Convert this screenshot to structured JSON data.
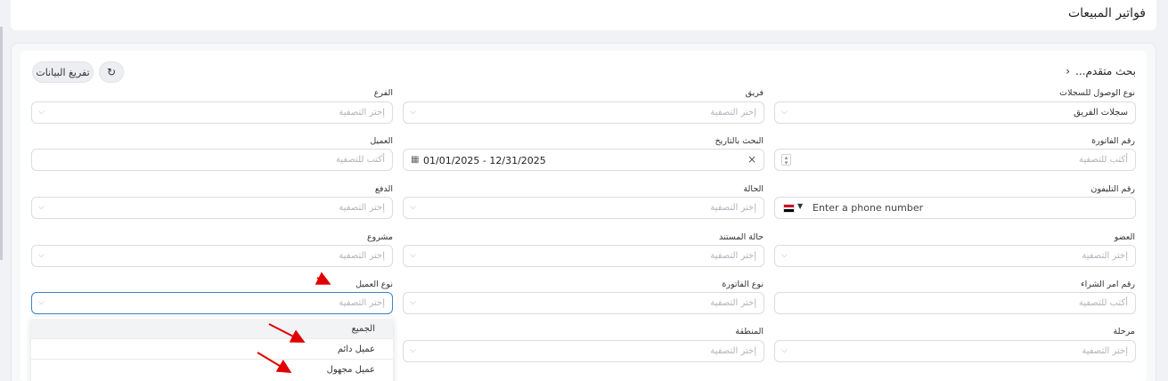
{
  "page": {
    "title": "فواتير المبيعات"
  },
  "toolbar": {
    "clear_label": "تفريغ البيانات",
    "refresh_icon": "refresh-icon"
  },
  "advanced_search": {
    "label": "بحث متقدم..."
  },
  "filters": {
    "access_type": {
      "label": "نوع الوصول للسجلات",
      "value": "سجلات الفريق"
    },
    "team": {
      "label": "فريق",
      "placeholder": "إختر التصفية"
    },
    "branch": {
      "label": "الفرع",
      "placeholder": "إختر التصفية"
    },
    "invoice_number": {
      "label": "رقم الفاتورة",
      "placeholder": "أكتب للتصفية"
    },
    "date_search": {
      "label": "البحث بالتاريخ",
      "value": "01/01/2025 - 12/31/2025"
    },
    "client": {
      "label": "العميل",
      "placeholder": "أكتب للتصفية"
    },
    "phone": {
      "label": "رقم التليفون",
      "placeholder": "Enter a phone number"
    },
    "status": {
      "label": "الحالة",
      "placeholder": "إختر التصفية"
    },
    "payment": {
      "label": "الدفع",
      "placeholder": "إختر التصفية"
    },
    "member": {
      "label": "العضو",
      "placeholder": "إختر التصفية"
    },
    "doc_status": {
      "label": "حالة المستند",
      "placeholder": "إختر التصفية"
    },
    "project": {
      "label": "مشروع",
      "placeholder": "إختر التصفية"
    },
    "po_number": {
      "label": "رقم امر الشراء",
      "placeholder": "أكتب للتصفية"
    },
    "invoice_type": {
      "label": "نوع الفاتورة",
      "placeholder": "إختر التصفية"
    },
    "client_type": {
      "label": "نوع العميل",
      "placeholder": "إختر التصفية"
    },
    "stage": {
      "label": "مرحلة",
      "placeholder": "إختر التصفية"
    },
    "region": {
      "label": "المنطقة",
      "placeholder": "إختر التصفية"
    }
  },
  "client_type_dropdown": {
    "options": [
      "الجميع",
      "عميل دائم",
      "عميل مجهول"
    ],
    "selected_index": 0
  },
  "colors": {
    "accent": "#3b82c8",
    "arrow": "#e00000"
  }
}
